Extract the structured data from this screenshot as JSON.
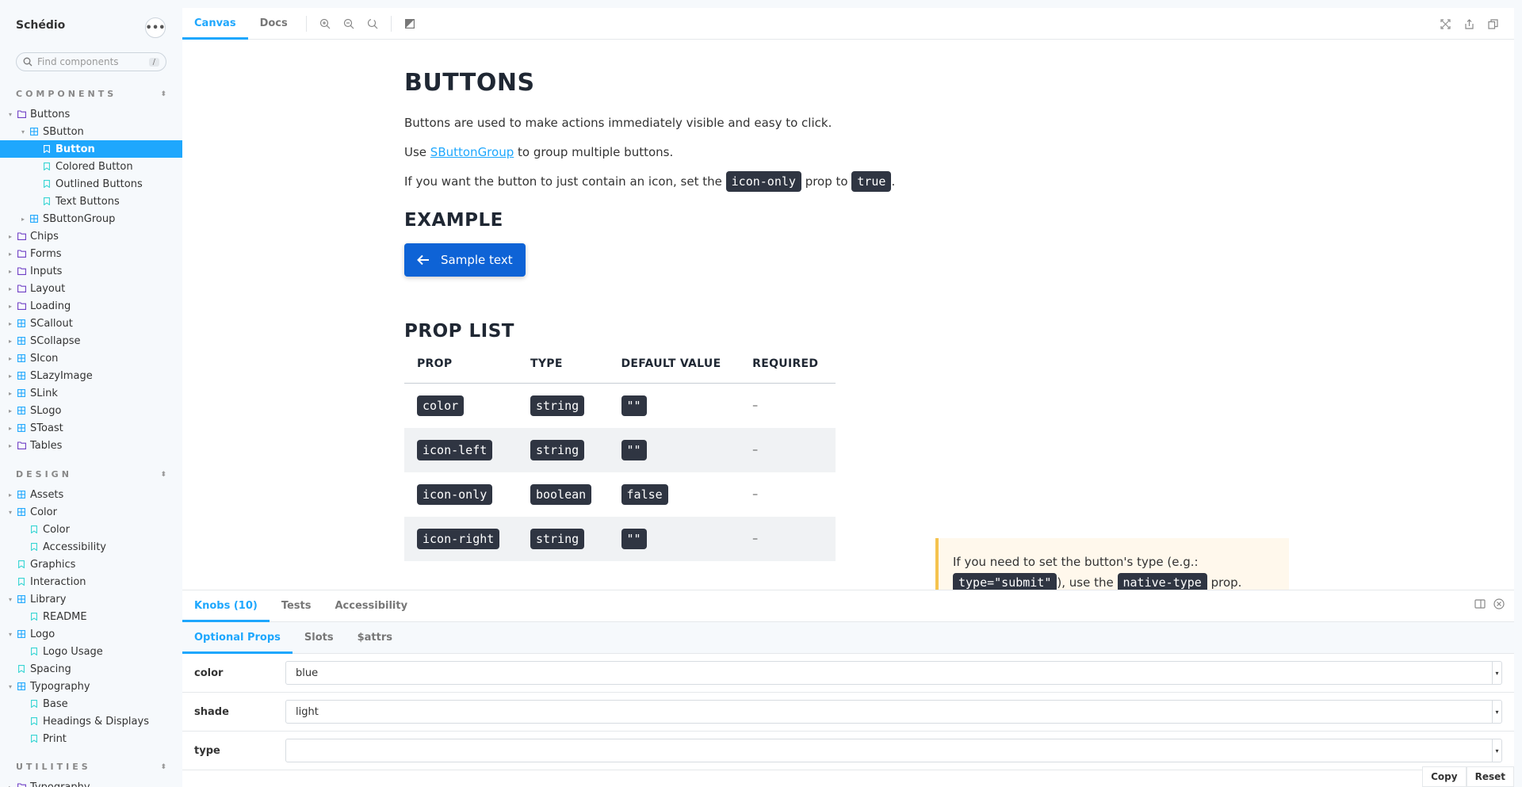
{
  "app": {
    "title": "Schédio",
    "menu_icon": "ellipsis-icon"
  },
  "search": {
    "placeholder": "Find components",
    "shortcut": "/"
  },
  "sections": {
    "components": {
      "label": "COMPONENTS"
    },
    "design": {
      "label": "DESIGN"
    },
    "utilities": {
      "label": "UTILITIES"
    }
  },
  "tree_components": [
    {
      "label": "Buttons",
      "type": "folder",
      "level": 0,
      "expanded": true
    },
    {
      "label": "SButton",
      "type": "component",
      "level": 1,
      "expanded": true
    },
    {
      "label": "Button",
      "type": "story",
      "level": 2,
      "selected": true
    },
    {
      "label": "Colored Button",
      "type": "story",
      "level": 2
    },
    {
      "label": "Outlined Buttons",
      "type": "story",
      "level": 2
    },
    {
      "label": "Text Buttons",
      "type": "story",
      "level": 2
    },
    {
      "label": "SButtonGroup",
      "type": "component",
      "level": 1,
      "expanded": false
    },
    {
      "label": "Chips",
      "type": "folder",
      "level": 0
    },
    {
      "label": "Forms",
      "type": "folder",
      "level": 0
    },
    {
      "label": "Inputs",
      "type": "folder",
      "level": 0
    },
    {
      "label": "Layout",
      "type": "folder",
      "level": 0
    },
    {
      "label": "Loading",
      "type": "folder",
      "level": 0
    },
    {
      "label": "SCallout",
      "type": "component",
      "level": 0
    },
    {
      "label": "SCollapse",
      "type": "component",
      "level": 0
    },
    {
      "label": "SIcon",
      "type": "component",
      "level": 0
    },
    {
      "label": "SLazyImage",
      "type": "component",
      "level": 0
    },
    {
      "label": "SLink",
      "type": "component",
      "level": 0
    },
    {
      "label": "SLogo",
      "type": "component",
      "level": 0
    },
    {
      "label": "SToast",
      "type": "component",
      "level": 0
    },
    {
      "label": "Tables",
      "type": "folder",
      "level": 0
    }
  ],
  "tree_design": [
    {
      "label": "Assets",
      "type": "component",
      "level": 0
    },
    {
      "label": "Color",
      "type": "component",
      "level": 0,
      "expanded": true
    },
    {
      "label": "Color",
      "type": "story",
      "level": 1
    },
    {
      "label": "Accessibility",
      "type": "story",
      "level": 1
    },
    {
      "label": "Graphics",
      "type": "story",
      "level": 0,
      "noarrow": true
    },
    {
      "label": "Interaction",
      "type": "story",
      "level": 0,
      "noarrow": true
    },
    {
      "label": "Library",
      "type": "component",
      "level": 0,
      "expanded": true
    },
    {
      "label": "README",
      "type": "story",
      "level": 1
    },
    {
      "label": "Logo",
      "type": "component",
      "level": 0,
      "expanded": true
    },
    {
      "label": "Logo Usage",
      "type": "story",
      "level": 1
    },
    {
      "label": "Spacing",
      "type": "story",
      "level": 0,
      "noarrow": true
    },
    {
      "label": "Typography",
      "type": "component",
      "level": 0,
      "expanded": true
    },
    {
      "label": "Base",
      "type": "story",
      "level": 1
    },
    {
      "label": "Headings & Displays",
      "type": "story",
      "level": 1
    },
    {
      "label": "Print",
      "type": "story",
      "level": 1
    }
  ],
  "tree_utilities": [
    {
      "label": "Typography",
      "type": "folder",
      "level": 0
    }
  ],
  "toolbar": {
    "tab_canvas": "Canvas",
    "tab_docs": "Docs"
  },
  "doc": {
    "title": "BUTTONS",
    "p1": "Buttons are used to make actions immediately visible and easy to click.",
    "p2_pre": "Use ",
    "p2_link": "SButtonGroup",
    "p2_post": " to group multiple buttons.",
    "p3_pre": "If you want the button to just contain an icon, set the ",
    "p3_code1": "icon-only",
    "p3_mid": " prop to ",
    "p3_code2": "true",
    "p3_post": ".",
    "example_title": "EXAMPLE",
    "sample_button": "Sample text",
    "proplist_title": "PROP LIST",
    "table_headers": [
      "PROP",
      "TYPE",
      "DEFAULT VALUE",
      "REQUIRED"
    ],
    "table_rows": [
      {
        "prop": "color",
        "type": "string",
        "default": "\"\"",
        "required": "–"
      },
      {
        "prop": "icon-left",
        "type": "string",
        "default": "\"\"",
        "required": "–"
      },
      {
        "prop": "icon-only",
        "type": "boolean",
        "default": "false",
        "required": "–"
      },
      {
        "prop": "icon-right",
        "type": "string",
        "default": "\"\"",
        "required": "–"
      }
    ],
    "callout_pre": "If you need to set the button's type (e.g.: ",
    "callout_code1": "type=\"submit\"",
    "callout_mid": "), use the ",
    "callout_code2": "native-type",
    "callout_post": " prop."
  },
  "panel": {
    "tabs": [
      "Knobs (10)",
      "Tests",
      "Accessibility"
    ],
    "subtabs": [
      "Optional Props",
      "Slots",
      "$attrs"
    ],
    "knobs": [
      {
        "label": "color",
        "value": "blue"
      },
      {
        "label": "shade",
        "value": "light"
      },
      {
        "label": "type",
        "value": ""
      }
    ],
    "copy": "Copy",
    "reset": "Reset"
  },
  "colors": {
    "accent": "#1ea7fd",
    "button": "#0e63d6",
    "code_bg": "#2f3542",
    "callout_border": "#f5c34e"
  }
}
